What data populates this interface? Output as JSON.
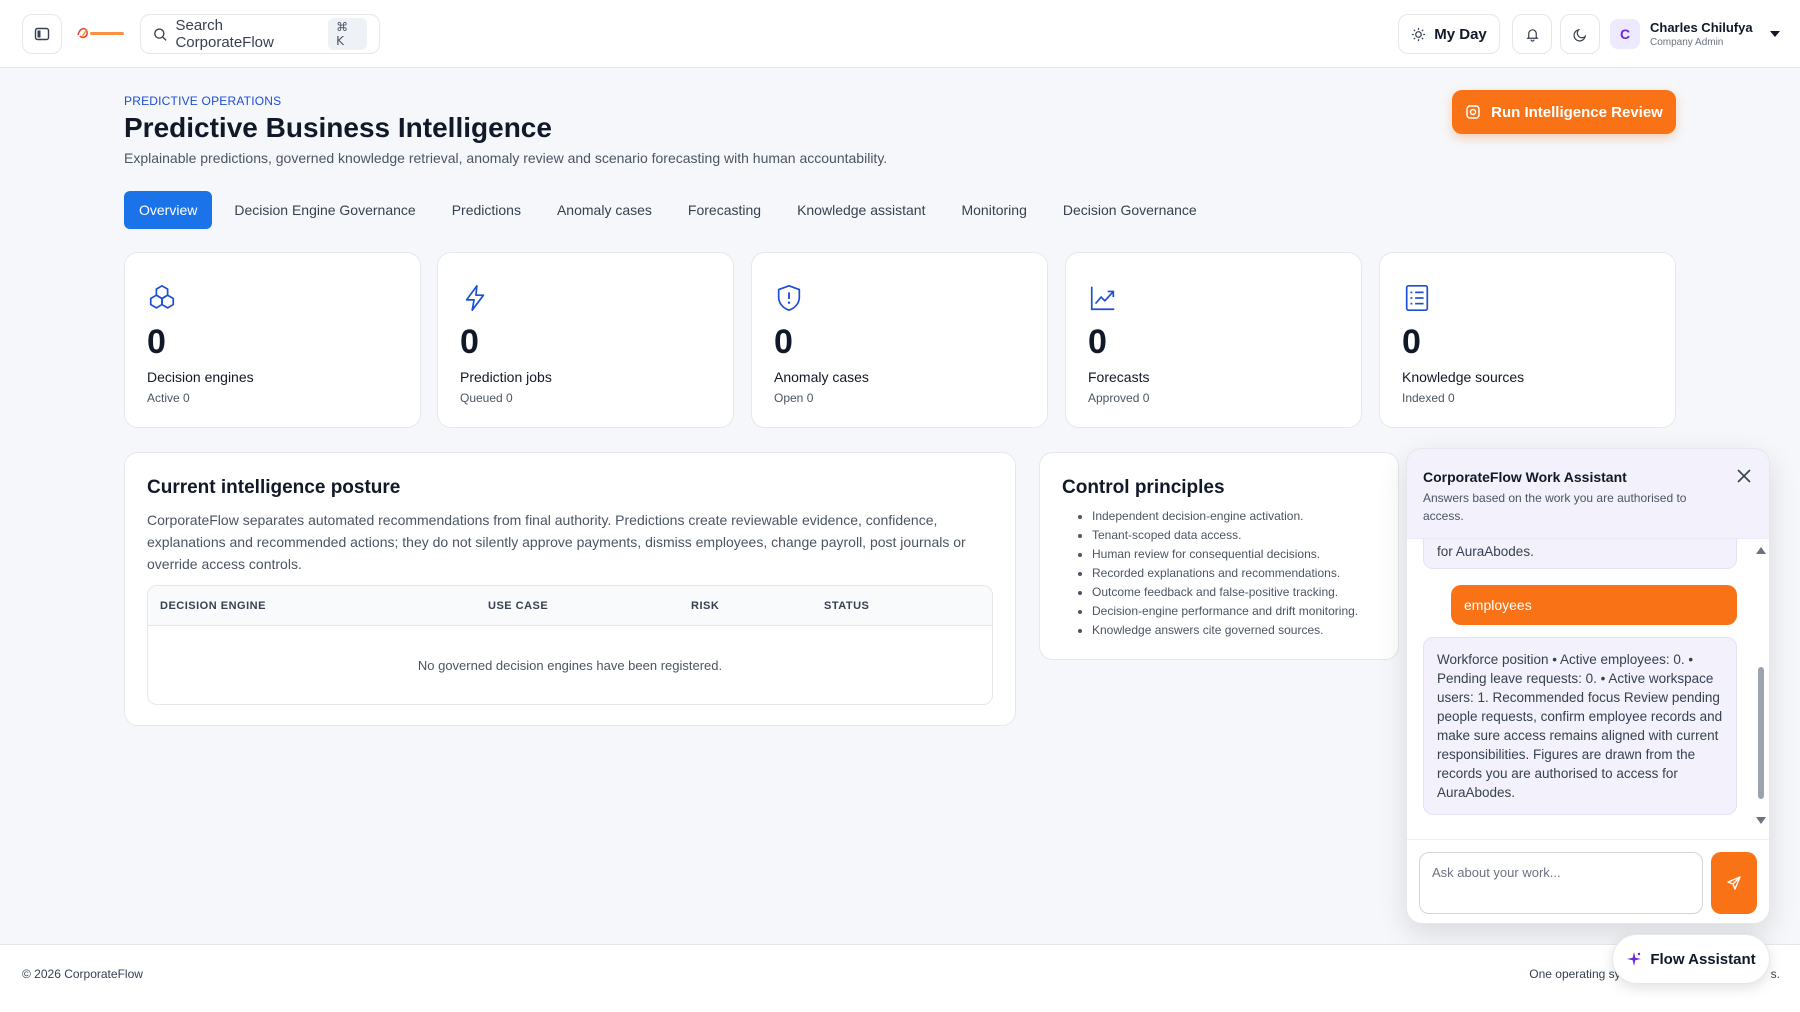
{
  "header": {
    "search_placeholder": "Search CorporateFlow",
    "search_shortcut": "⌘ K",
    "my_day_label": "My Day",
    "user": {
      "initial": "C",
      "name": "Charles Chilufya",
      "role": "Company Admin"
    }
  },
  "page": {
    "eyebrow": "PREDICTIVE OPERATIONS",
    "title": "Predictive Business Intelligence",
    "subtitle": "Explainable predictions, governed knowledge retrieval, anomaly review and scenario forecasting with human accountability.",
    "run_button": "Run Intelligence Review"
  },
  "tabs": [
    {
      "label": "Overview",
      "active": true
    },
    {
      "label": "Decision Engine Governance",
      "active": false
    },
    {
      "label": "Predictions",
      "active": false
    },
    {
      "label": "Anomaly cases",
      "active": false
    },
    {
      "label": "Forecasting",
      "active": false
    },
    {
      "label": "Knowledge assistant",
      "active": false
    },
    {
      "label": "Monitoring",
      "active": false
    },
    {
      "label": "Decision Governance",
      "active": false
    }
  ],
  "kpis": [
    {
      "icon": "cubes-icon",
      "value": "0",
      "label": "Decision engines",
      "sub": "Active 0"
    },
    {
      "icon": "lightning-icon",
      "value": "0",
      "label": "Prediction jobs",
      "sub": "Queued 0"
    },
    {
      "icon": "shield-alert-icon",
      "value": "0",
      "label": "Anomaly cases",
      "sub": "Open 0"
    },
    {
      "icon": "trending-up-icon",
      "value": "0",
      "label": "Forecasts",
      "sub": "Approved 0"
    },
    {
      "icon": "document-list-icon",
      "value": "0",
      "label": "Knowledge sources",
      "sub": "Indexed 0"
    }
  ],
  "posture": {
    "title": "Current intelligence posture",
    "description": "CorporateFlow separates automated recommendations from final authority. Predictions create reviewable evidence, confidence, explanations and recommended actions; they do not silently approve payments, dismiss employees, change payroll, post journals or override access controls.",
    "columns": [
      "DECISION ENGINE",
      "USE CASE",
      "RISK",
      "STATUS"
    ],
    "empty_text": "No governed decision engines have been registered."
  },
  "control": {
    "title": "Control principles",
    "items": [
      "Independent decision-engine activation.",
      "Tenant-scoped data access.",
      "Human review for consequential decisions.",
      "Recorded explanations and recommendations.",
      "Outcome feedback and false-positive tracking.",
      "Decision-engine performance and drift monitoring.",
      "Knowledge answers cite governed sources."
    ]
  },
  "assistant": {
    "title": "CorporateFlow Work Assistant",
    "subtitle": "Answers based on the work you are authorised to access.",
    "prev_message_tail": "for AuraAbodes.",
    "user_message": "employees",
    "bot_message": "Workforce position • Active employees: 0. • Pending leave requests: 0. • Active workspace users: 1. Recommended focus Review pending people requests, confirm employee records and make sure access remains aligned with current responsibilities. Figures are drawn from the records you are authorised to access for AuraAbodes.",
    "input_placeholder": "Ask about your work..."
  },
  "footer": {
    "copyright": "© 2026 CorporateFlow",
    "right_text": "One operating sy",
    "right_text_tail": "s."
  },
  "flow_button": "Flow Assistant",
  "colors": {
    "primary_blue": "#1a73e8",
    "accent_orange": "#f97316",
    "assistant_tint": "#f3f1fb"
  }
}
